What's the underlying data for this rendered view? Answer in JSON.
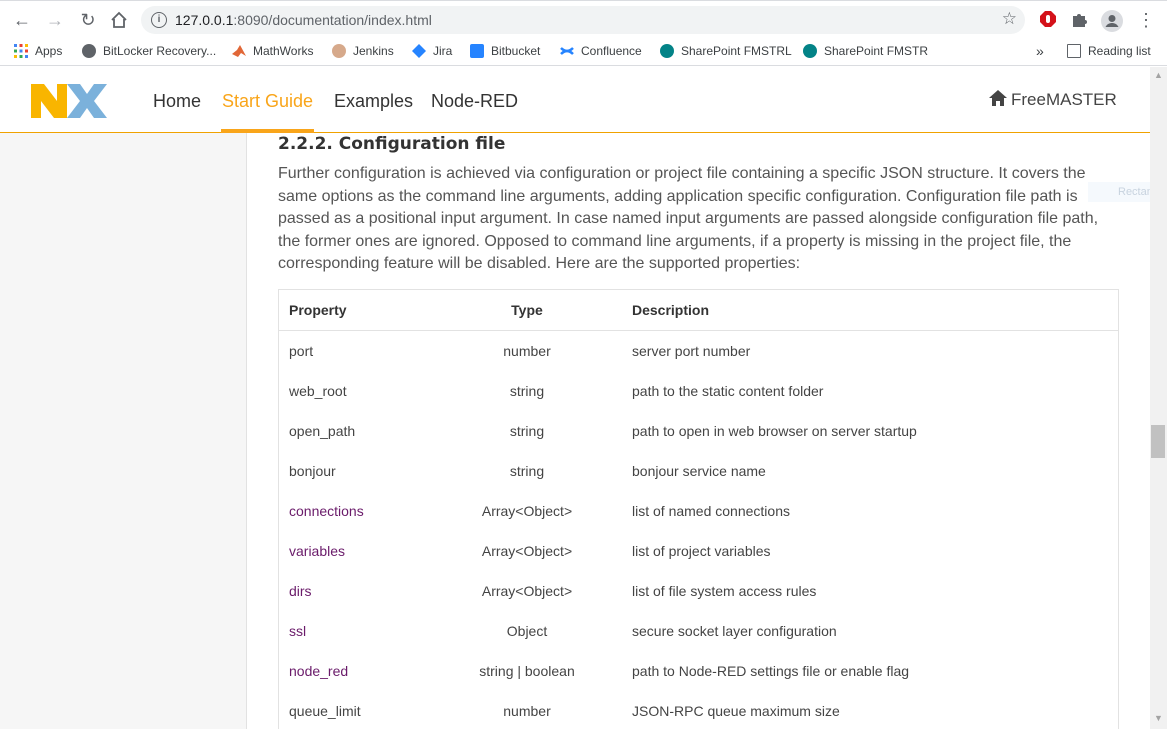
{
  "browser": {
    "url_host": "127.0.0.1",
    "url_path": ":8090/documentation/index.html",
    "bookmarks": [
      {
        "label": "Apps",
        "icon": "apps-grid-icon"
      },
      {
        "label": "BitLocker Recovery...",
        "icon": "bitlocker-icon"
      },
      {
        "label": "MathWorks",
        "icon": "mathworks-icon"
      },
      {
        "label": "Jenkins",
        "icon": "jenkins-icon"
      },
      {
        "label": "Jira",
        "icon": "jira-icon"
      },
      {
        "label": "Bitbucket",
        "icon": "bitbucket-icon"
      },
      {
        "label": "Confluence",
        "icon": "confluence-icon"
      },
      {
        "label": "SharePoint FMSTRL",
        "icon": "sharepoint-icon"
      },
      {
        "label": "SharePoint FMSTR",
        "icon": "sharepoint-icon"
      }
    ],
    "overflow_label": "»",
    "reading_list": "Reading list"
  },
  "header": {
    "menu": [
      {
        "label": "Home",
        "active": false
      },
      {
        "label": "Start Guide",
        "active": true
      },
      {
        "label": "Examples",
        "active": false
      },
      {
        "label": "Node-RED",
        "active": false
      }
    ],
    "brand": "FreeMASTER",
    "accent_color": "#f9a51a"
  },
  "content": {
    "section_title": "2.2.2. Configuration file",
    "paragraph": "Further configuration is achieved via configuration or project file containing a specific JSON structure. It covers the same options as the command line arguments, adding application specific configuration. Configuration file path is passed as a positional input argument. In case named input arguments are passed alongside configuration file path, the former ones are ignored. Opposed to command line arguments, if a property is missing in the project file, the corresponding feature will be disabled. Here are the supported properties:",
    "ghost_label": "Rectangle",
    "table": {
      "headers": [
        "Property",
        "Type",
        "Description"
      ],
      "rows": [
        {
          "property": "port",
          "type": "number",
          "description": "server port number",
          "link": false
        },
        {
          "property": "web_root",
          "type": "string",
          "description": "path to the static content folder",
          "link": false
        },
        {
          "property": "open_path",
          "type": "string",
          "description": "path to open in web browser on server startup",
          "link": false
        },
        {
          "property": "bonjour",
          "type": "string",
          "description": "bonjour service name",
          "link": false
        },
        {
          "property": "connections",
          "type": "Array<Object>",
          "description": "list of named connections",
          "link": true
        },
        {
          "property": "variables",
          "type": "Array<Object>",
          "description": "list of project variables",
          "link": true
        },
        {
          "property": "dirs",
          "type": "Array<Object>",
          "description": "list of file system access rules",
          "link": true
        },
        {
          "property": "ssl",
          "type": "Object",
          "description": "secure socket layer configuration",
          "link": true
        },
        {
          "property": "node_red",
          "type": "string | boolean",
          "description": "path to Node-RED settings file or enable flag",
          "link": true
        },
        {
          "property": "queue_limit",
          "type": "number",
          "description": "JSON-RPC queue maximum size",
          "link": false
        }
      ]
    }
  }
}
